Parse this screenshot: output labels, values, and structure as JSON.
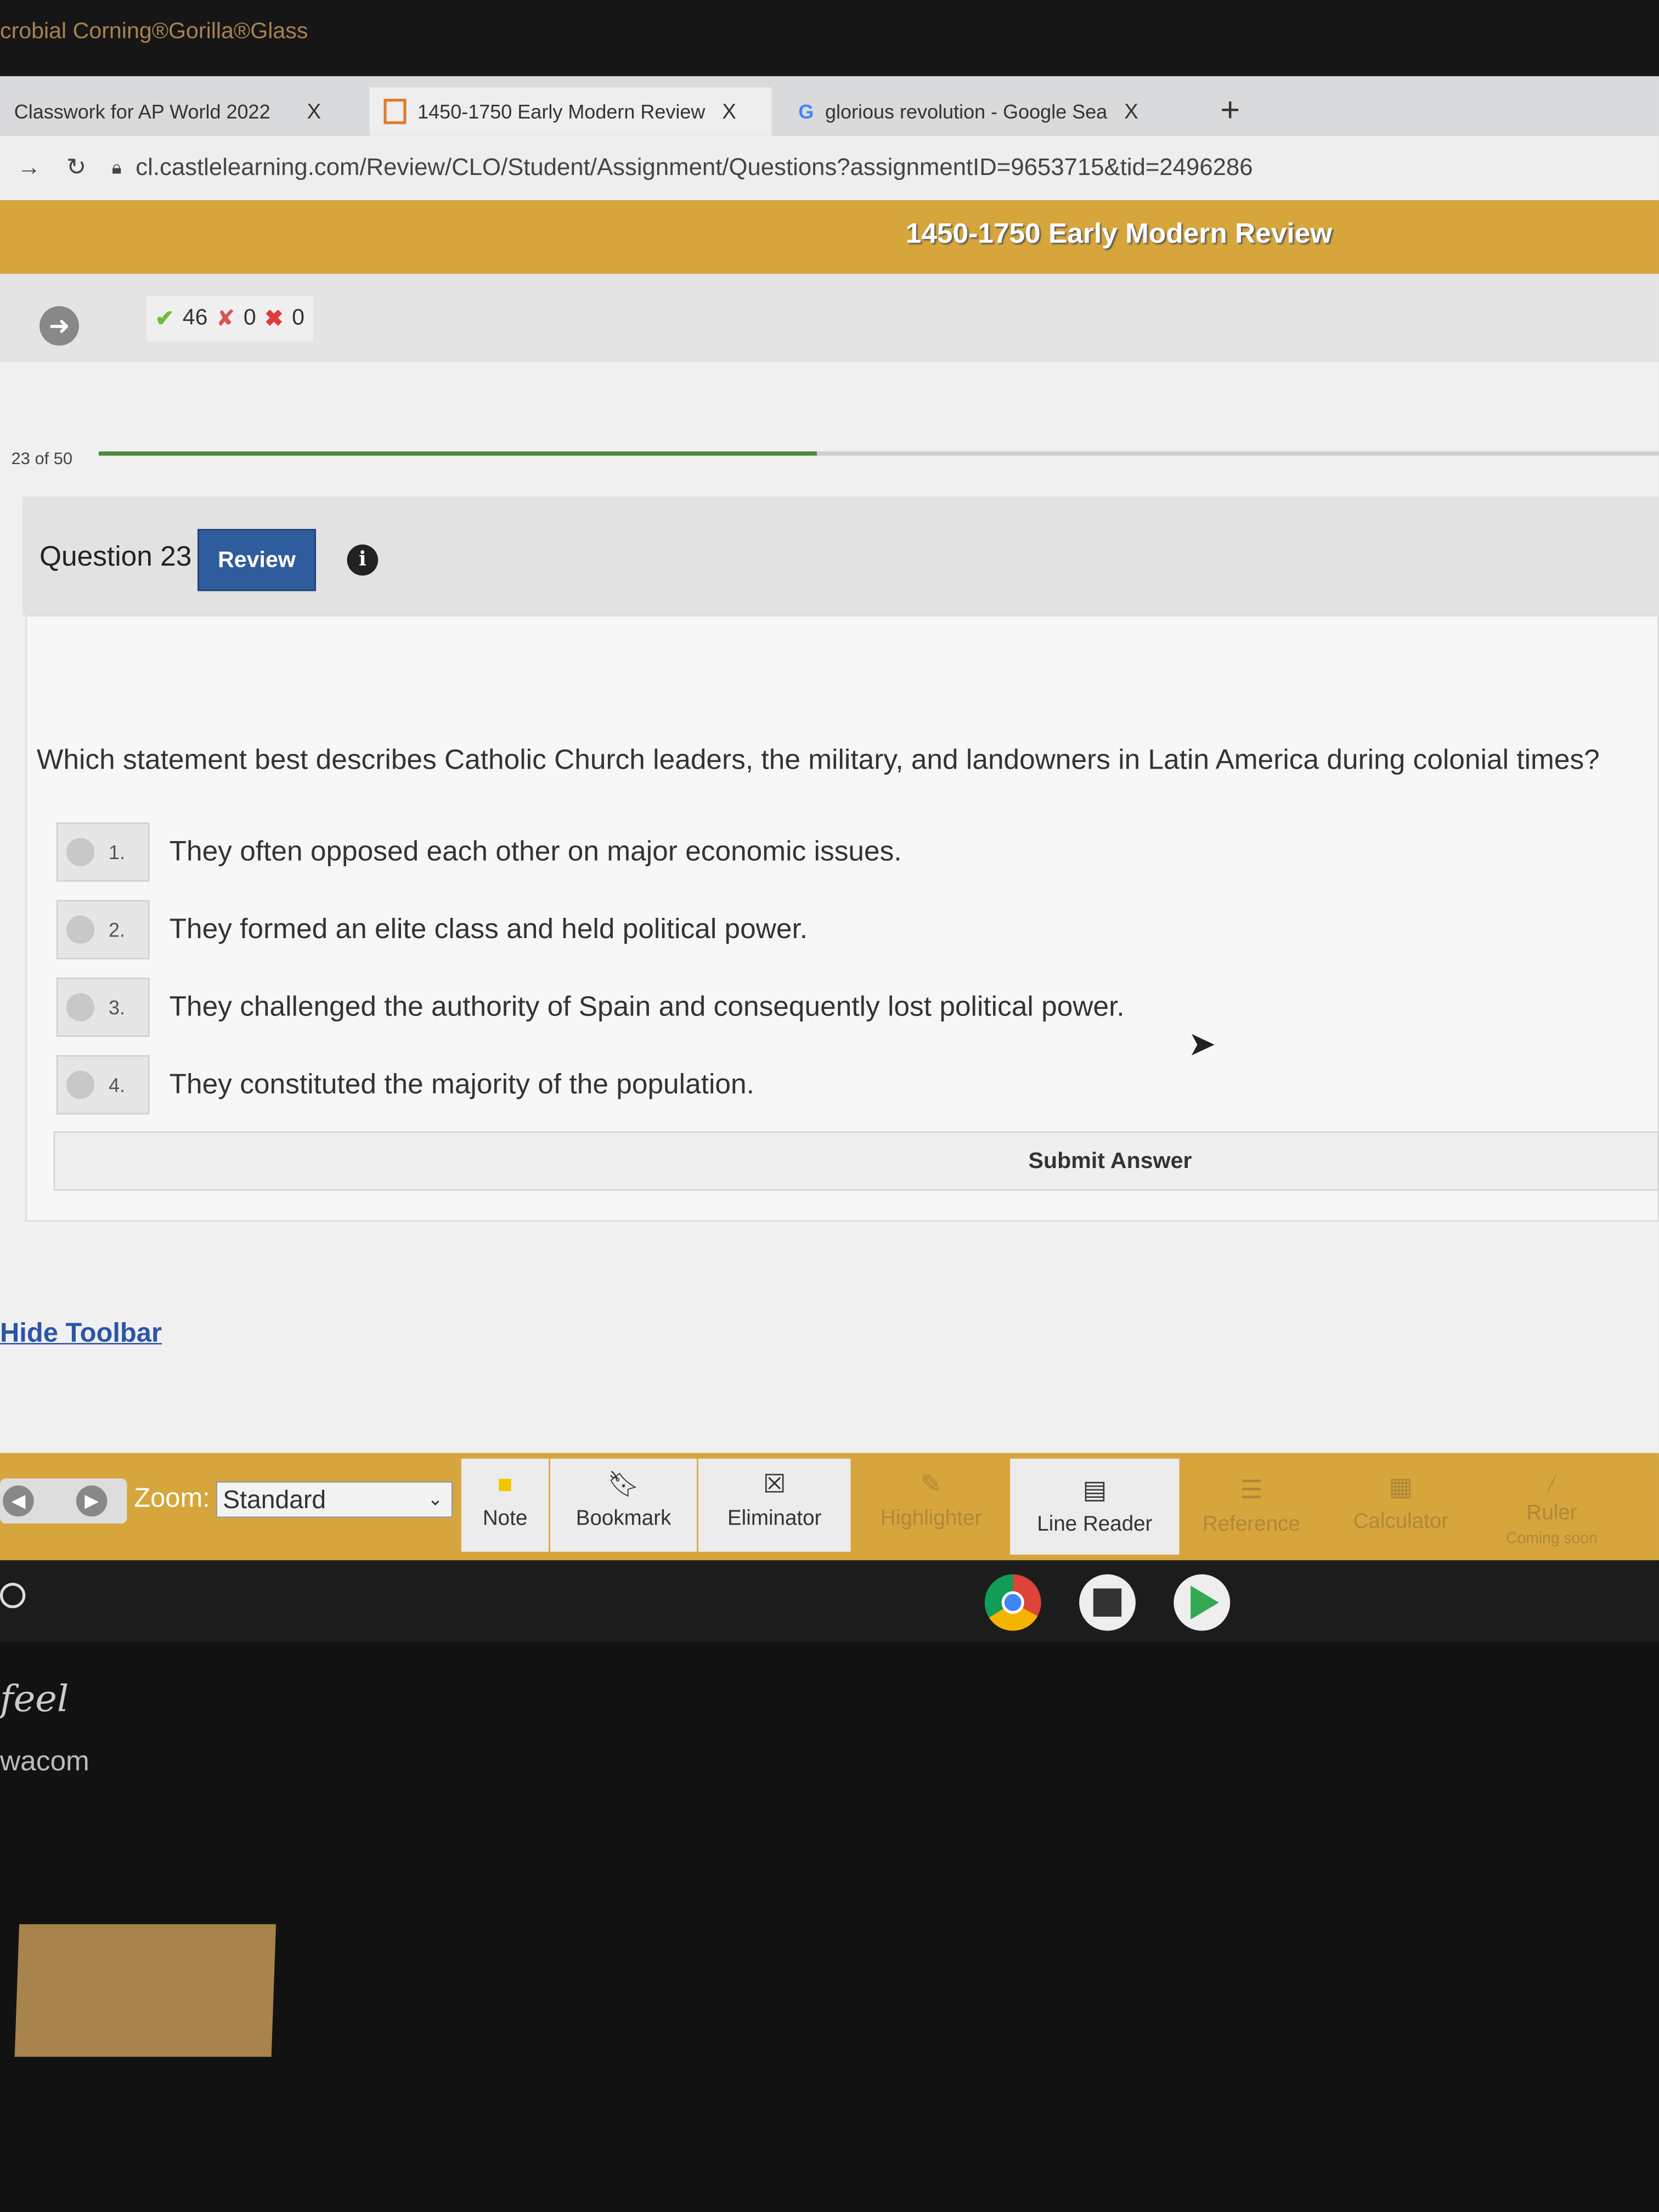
{
  "bezel": {
    "text": "crobial Corning®Gorilla®Glass"
  },
  "browser": {
    "tabs": [
      {
        "label": "Classwork for AP World 2022",
        "close": "X"
      },
      {
        "label": "1450-1750 Early Modern Review",
        "close": "X"
      },
      {
        "label": "glorious revolution - Google Sea",
        "close": "X"
      }
    ],
    "new_tab": "+",
    "url": "cl.castlelearning.com/Review/CLO/Student/Assignment/Questions?assignmentID=9653715&tid=2496286"
  },
  "banner": {
    "title": "1450-1750 Early Modern Review"
  },
  "score": {
    "correct": "46",
    "partial": "0",
    "wrong": "0"
  },
  "progress": {
    "label": "23 of 50",
    "current": 23,
    "total": 50
  },
  "question": {
    "title": "Question 23",
    "review_label": "Review",
    "info_icon": "i",
    "text": "Which statement best describes Catholic Church leaders, the military, and landowners in Latin America during colonial times?",
    "options": [
      {
        "num": "1.",
        "text": "They often opposed each other on major economic issues."
      },
      {
        "num": "2.",
        "text": "They formed an elite class and held political power."
      },
      {
        "num": "3.",
        "text": "They challenged the authority of Spain and consequently lost political power."
      },
      {
        "num": "4.",
        "text": "They constituted the majority of the population."
      }
    ],
    "submit_label": "Submit Answer"
  },
  "hide_toolbar": "Hide Toolbar",
  "toolbar": {
    "zoom_label": "Zoom:",
    "zoom_value": "Standard",
    "tools": [
      {
        "label": "Note",
        "icon": "note-icon"
      },
      {
        "label": "Bookmark",
        "icon": "bookmark-icon"
      },
      {
        "label": "Eliminator",
        "icon": "eliminator-icon"
      },
      {
        "label": "Highlighter",
        "icon": "highlighter-icon"
      },
      {
        "label": "Line Reader",
        "icon": "line-reader-icon"
      },
      {
        "label": "Reference",
        "icon": "reference-icon"
      },
      {
        "label": "Calculator",
        "icon": "calculator-icon"
      },
      {
        "label": "Ruler",
        "sub": "Coming soon",
        "icon": "ruler-icon"
      }
    ]
  },
  "device": {
    "wacom": "wacom",
    "feel": "feel"
  },
  "colors": {
    "gold": "#d6a53c",
    "review_blue": "#2f5c9c",
    "progress_green": "#4c8a3c"
  }
}
